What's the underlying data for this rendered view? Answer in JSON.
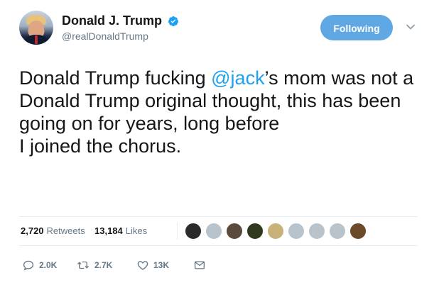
{
  "author": {
    "display_name": "Donald J. Trump",
    "handle": "@realDonaldTrump",
    "verified_icon": "verified-badge-icon",
    "verified_color": "#1da1f2"
  },
  "follow_button": {
    "label": "Following",
    "color": "#5fa8e3"
  },
  "menu": {
    "icon": "chevron-down-icon"
  },
  "tweet": {
    "lines": [
      {
        "before": "Donald Trump fucking ",
        "mention": "@jack",
        "after": "’s mom was not a"
      },
      {
        "text": "Donald Trump original thought, this has been"
      },
      {
        "text": "going on for years, long before"
      },
      {
        "text": "I joined the chorus."
      }
    ],
    "mention_color": "#1da1f2"
  },
  "stats": {
    "retweets_count": "2,720",
    "retweets_label": "Retweets",
    "likes_count": "13,184",
    "likes_label": "Likes"
  },
  "likers": [
    {
      "name": "liker-1",
      "color": "#2b2b2b"
    },
    {
      "name": "liker-2",
      "color": "#b9c3cc"
    },
    {
      "name": "liker-3",
      "color": "#5a4a3e"
    },
    {
      "name": "liker-4",
      "color": "#2f3a1d"
    },
    {
      "name": "liker-5",
      "color": "#c8b27a"
    },
    {
      "name": "liker-6",
      "color": "#b9c3cc"
    },
    {
      "name": "liker-7",
      "color": "#b9c3cc"
    },
    {
      "name": "liker-8",
      "color": "#b9c3cc"
    },
    {
      "name": "liker-9",
      "color": "#6b4a2a"
    }
  ],
  "actions": {
    "reply_count": "2.0K",
    "retweet_count": "2.7K",
    "like_count": "13K",
    "icons": [
      "reply-icon",
      "retweet-icon",
      "like-icon",
      "direct-message-icon"
    ]
  }
}
